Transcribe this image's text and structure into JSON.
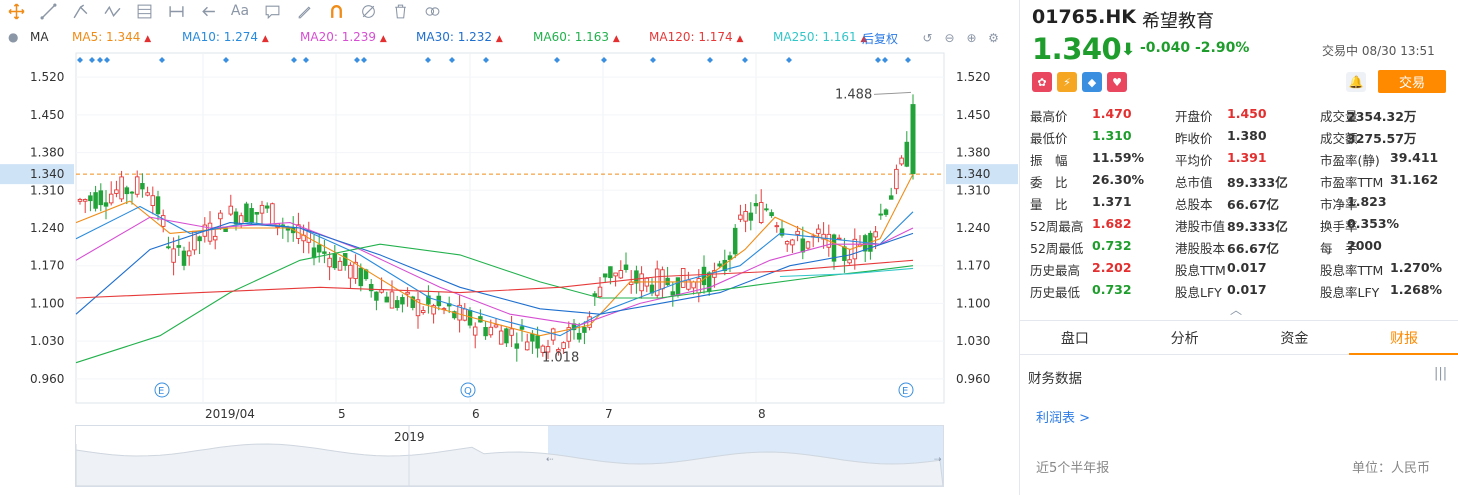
{
  "ma_bar": {
    "label": "MA",
    "ma5": "MA5: 1.344",
    "ma10": "MA10: 1.274",
    "ma20": "MA20: 1.239",
    "ma30": "MA30: 1.232",
    "ma60": "MA60: 1.163",
    "ma120": "MA120: 1.174",
    "ma250": "MA250: 1.161",
    "adjust": "后复权",
    "colors": {
      "ma5": "#f08c18",
      "ma10": "#2a8bdc",
      "ma20": "#d64fd2",
      "ma30": "#1f6fcf",
      "ma60": "#22b14c",
      "ma120": "#e63a3a",
      "ma250": "#33c6c9"
    }
  },
  "chart": {
    "price_ticks": [
      "1.520",
      "1.450",
      "1.380",
      "1.310",
      "1.240",
      "1.170",
      "1.100",
      "1.030",
      "0.960"
    ],
    "current_label": "1.340",
    "high_annot": "1.488",
    "low_annot": "1.018",
    "x_labels": [
      "2019/04",
      "5",
      "6",
      "7",
      "8"
    ],
    "event_markers": [
      "E",
      "Q",
      "E"
    ],
    "navigator_label": "2019"
  },
  "chart_data": {
    "type": "candlestick",
    "ylim": [
      0.93,
      1.55
    ],
    "current_price": 1.34,
    "x": [
      "2019/04",
      "5",
      "6",
      "7",
      "8"
    ],
    "series": [
      {
        "name": "MA5",
        "value": 1.344
      },
      {
        "name": "MA10",
        "value": 1.274
      },
      {
        "name": "MA20",
        "value": 1.239
      },
      {
        "name": "MA30",
        "value": 1.232
      },
      {
        "name": "MA60",
        "value": 1.163
      },
      {
        "name": "MA120",
        "value": 1.174
      },
      {
        "name": "MA250",
        "value": 1.161
      }
    ],
    "annotations": [
      {
        "label": "1.488"
      },
      {
        "label": "1.018"
      }
    ]
  },
  "quote": {
    "code": "01765.HK",
    "name": "希望教育",
    "price": "1.340",
    "change": "-0.040",
    "change_pct": "-2.90%",
    "status": "交易中 08/30 13:51",
    "trade_btn": "交易",
    "flag_colors": [
      "#e8475f",
      "#f5a623",
      "#3b8fe0",
      "#e8475f"
    ]
  },
  "stats": [
    [
      {
        "l": "最高价",
        "v": "1.470",
        "c": "red"
      },
      {
        "l": "开盘价",
        "v": "1.450",
        "c": "red"
      },
      {
        "l": "成交量",
        "v": "2354.32万",
        "c": ""
      }
    ],
    [
      {
        "l": "最低价",
        "v": "1.310",
        "c": "green"
      },
      {
        "l": "昨收价",
        "v": "1.380",
        "c": ""
      },
      {
        "l": "成交额",
        "v": "3275.57万",
        "c": ""
      }
    ],
    [
      {
        "l": "振　幅",
        "v": "11.59%",
        "c": ""
      },
      {
        "l": "平均价",
        "v": "1.391",
        "c": "red"
      },
      {
        "l": "市盈率(静)",
        "v": "39.411",
        "c": ""
      }
    ],
    [
      {
        "l": "委　比",
        "v": "26.30%",
        "c": ""
      },
      {
        "l": "总市值",
        "v": "89.333亿",
        "c": ""
      },
      {
        "l": "市盈率TTM",
        "v": "31.162",
        "c": ""
      }
    ],
    [
      {
        "l": "量　比",
        "v": "1.371",
        "c": ""
      },
      {
        "l": "总股本",
        "v": "66.67亿",
        "c": ""
      },
      {
        "l": "市净率",
        "v": "1.823",
        "c": ""
      }
    ],
    [
      {
        "l": "52周最高",
        "v": "1.682",
        "c": "red"
      },
      {
        "l": "港股市值",
        "v": "89.333亿",
        "c": ""
      },
      {
        "l": "换手率",
        "v": "0.353%",
        "c": ""
      }
    ],
    [
      {
        "l": "52周最低",
        "v": "0.732",
        "c": "green"
      },
      {
        "l": "港股股本",
        "v": "66.67亿",
        "c": ""
      },
      {
        "l": "每　手",
        "v": "2000",
        "c": ""
      }
    ],
    [
      {
        "l": "历史最高",
        "v": "2.202",
        "c": "red"
      },
      {
        "l": "股息TTM",
        "v": "0.017",
        "c": ""
      },
      {
        "l": "股息率TTM",
        "v": "1.270%",
        "c": ""
      }
    ],
    [
      {
        "l": "历史最低",
        "v": "0.732",
        "c": "green"
      },
      {
        "l": "股息LFY",
        "v": "0.017",
        "c": ""
      },
      {
        "l": "股息率LFY",
        "v": "1.268%",
        "c": ""
      }
    ]
  ],
  "tabs": [
    "盘口",
    "分析",
    "资金",
    "财报"
  ],
  "finance": {
    "title": "财务数据",
    "link": "利润表 >",
    "period": "近5个半年报",
    "unit": "单位：人民币"
  }
}
